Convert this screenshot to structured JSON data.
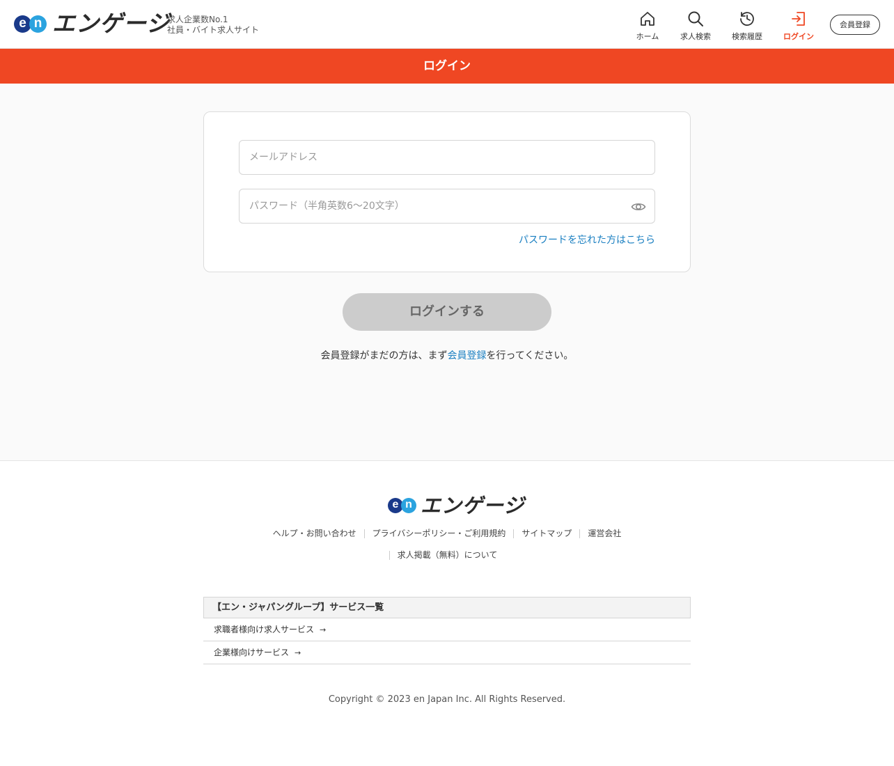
{
  "header": {
    "logo_text": "エンゲージ",
    "logo_badge_e": "e",
    "logo_badge_n": "n",
    "tagline_1": "求人企業数No.1",
    "tagline_2": "社員・バイト求人サイト",
    "nav": [
      {
        "label": "ホーム",
        "icon": "home-icon"
      },
      {
        "label": "求人検索",
        "icon": "search-icon"
      },
      {
        "label": "検索履歴",
        "icon": "history-icon"
      },
      {
        "label": "ログイン",
        "icon": "login-icon",
        "active": true
      }
    ],
    "register_label": "会員登録"
  },
  "titlebar": {
    "title": "ログイン"
  },
  "form": {
    "email_placeholder": "メールアドレス",
    "email_value": "",
    "password_placeholder": "パスワード（半角英数6〜20文字）",
    "password_value": "",
    "forgot_label": "パスワードを忘れた方はこちら",
    "login_button": "ログインする",
    "note_before": "会員登録がまだの方は、まず",
    "note_link": "会員登録",
    "note_after": "を行ってください。"
  },
  "footer": {
    "logo_text": "エンゲージ",
    "links_row1": [
      "ヘルプ・お問い合わせ",
      "プライバシーポリシー・ご利用規約",
      "サイトマップ",
      "運営会社"
    ],
    "links_row2": [
      "求人掲載（無料）について"
    ],
    "group_title": "【エン・ジャパングループ】サービス一覧",
    "group_rows": [
      "求職者様向け求人サービス",
      "企業様向けサービス"
    ],
    "copyright": "Copyright © 2023 en Japan Inc. All Rights Reserved."
  },
  "colors": {
    "accent": "#ef4723",
    "link": "#1a7fc1",
    "disabled_button": "#cccccc",
    "logo_blue_dark": "#1a3a8a",
    "logo_blue_light": "#2ba3df"
  }
}
